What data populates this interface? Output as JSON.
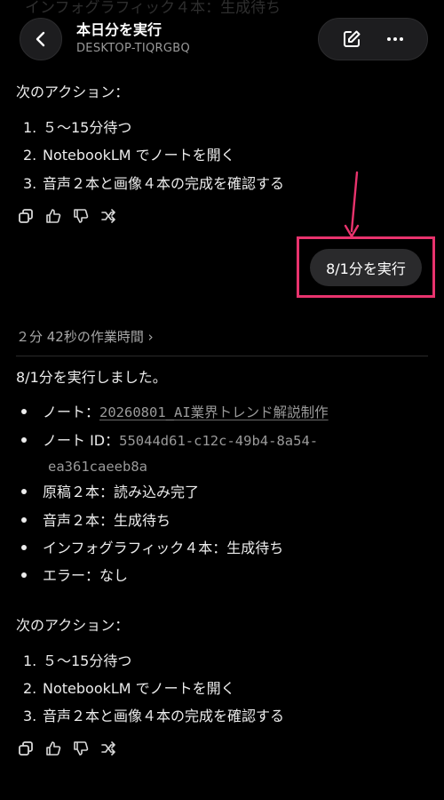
{
  "header": {
    "title": "本日分を実行",
    "subtitle": "DESKTOP-TIQRGBQ",
    "ghost_line": "インフォグラフィック４本：生成待ち"
  },
  "prev_message": {
    "next_label": "次のアクション：",
    "steps": [
      {
        "num": "1.",
        "text": "５〜15分待つ"
      },
      {
        "num": "2.",
        "text": "NotebookLM でノートを開く"
      },
      {
        "num": "3.",
        "text": "音声２本と画像４本の完成を確認する"
      }
    ]
  },
  "user_message": {
    "text": "8/1分を実行"
  },
  "work_time": "２分 42秒の作業時間 ›",
  "response": {
    "intro": "8/1分を実行しました。",
    "bullets": {
      "note_label": "ノート：",
      "note_value": "20260801_AI業界トレンド解説制作",
      "note_id_label": "ノート ID：",
      "note_id_value_1": "55044d61-c12c-49b4-8a54-",
      "note_id_value_2": "ea361caeeb8a",
      "manuscript": "原稿２本：読み込み完了",
      "audio": "音声２本：生成待ち",
      "infographic": "インフォグラフィック４本：生成待ち",
      "error": "エラー：なし"
    },
    "next_label": "次のアクション：",
    "steps": [
      {
        "num": "1.",
        "text": "５〜15分待つ"
      },
      {
        "num": "2.",
        "text": "NotebookLM でノートを開く"
      },
      {
        "num": "3.",
        "text": "音声２本と画像４本の完成を確認する"
      }
    ]
  },
  "colors": {
    "background": "#000000",
    "text": "#ececec",
    "muted": "#9a9a9a",
    "highlight_box": "#e8336d",
    "bubble": "#2a2a2c"
  },
  "icons": [
    "chevron-left-icon",
    "edit-icon",
    "more-icon",
    "copy-icon",
    "thumbs-up-icon",
    "thumbs-down-icon",
    "share-icon",
    "arrow-down-icon"
  ]
}
